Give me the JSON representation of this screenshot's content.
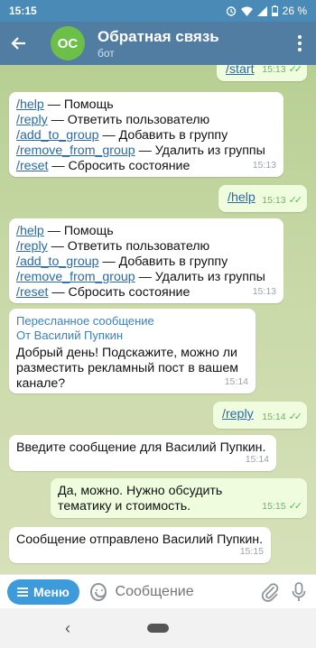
{
  "status": {
    "time": "15:15",
    "battery": "26 %"
  },
  "header": {
    "avatar": "OC",
    "title": "Обратная связь",
    "subtitle": "бот"
  },
  "messages": [
    {
      "type": "out",
      "text": "/start",
      "time": "15:13"
    },
    {
      "type": "in",
      "lines": [
        {
          "cmd": "/help",
          "desc": " — Помощь"
        },
        {
          "cmd": "/reply",
          "desc": " — Ответить пользователю"
        },
        {
          "cmd": "/add_to_group",
          "desc": " — Добавить в группу"
        },
        {
          "cmd": "/remove_from_group",
          "desc": " — Удалить из группы"
        },
        {
          "cmd": "/reset",
          "desc": " — Сбросить состояние"
        }
      ],
      "time": "15:13"
    },
    {
      "type": "out",
      "text": "/help",
      "time": "15:13"
    },
    {
      "type": "in",
      "lines": [
        {
          "cmd": "/help",
          "desc": " — Помощь"
        },
        {
          "cmd": "/reply",
          "desc": " — Ответить пользователю"
        },
        {
          "cmd": "/add_to_group",
          "desc": " — Добавить в группу"
        },
        {
          "cmd": "/remove_from_group",
          "desc": " — Удалить из группы"
        },
        {
          "cmd": "/reset",
          "desc": " — Сбросить состояние"
        }
      ],
      "time": "15:13"
    },
    {
      "type": "in-forward",
      "forward_title": "Пересланное сообщение",
      "forward_from": "От Василий Пупкин",
      "text": "Добрый день! Подскажите, можно ли разместить рекламный пост в вашем канале?",
      "time": "15:14"
    },
    {
      "type": "out",
      "text": "/reply",
      "time": "15:14"
    },
    {
      "type": "in",
      "text": "Введите сообщение для Василий Пупкин.",
      "time": "15:14"
    },
    {
      "type": "out",
      "text": "Да, можно. Нужно обсудить тематику и стоимость.",
      "time": "15:15"
    },
    {
      "type": "in",
      "text": "Сообщение отправлено Василий Пупкин.",
      "time": "15:15"
    }
  ],
  "composer": {
    "menu_label": "Меню",
    "placeholder": "Сообщение"
  },
  "icons": {
    "back": "arrow-left-icon",
    "more": "more-vertical-icon",
    "attach": "paperclip-icon",
    "mic": "microphone-icon",
    "emoji": "smile-icon",
    "read": "double-check-icon"
  },
  "colors": {
    "header": "#527da3",
    "avatar": "#6cc04a",
    "outgoing_bubble": "#effdde",
    "link": "#2a6aa9",
    "menu_button": "#3d9bdb"
  }
}
